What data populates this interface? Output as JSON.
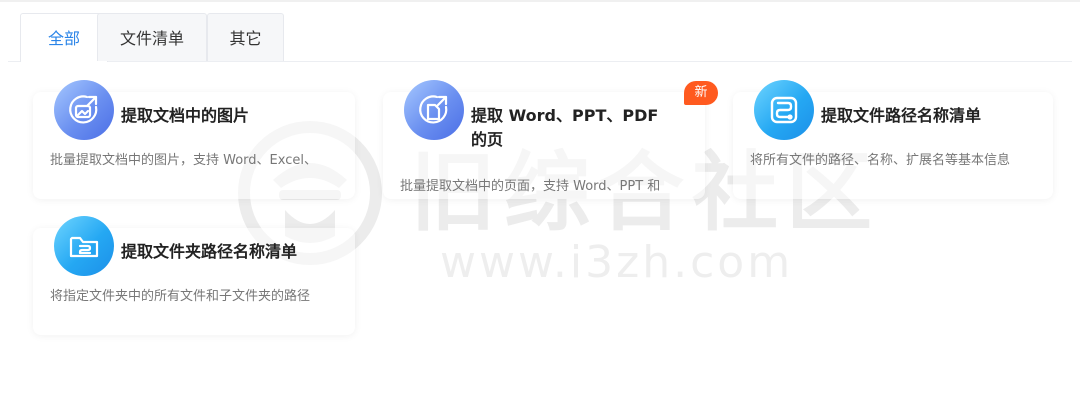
{
  "tabs": [
    {
      "label": "全部",
      "active": true
    },
    {
      "label": "文件清单",
      "active": false
    },
    {
      "label": "其它",
      "active": false
    }
  ],
  "cards": [
    {
      "title": "提取文档中的图片",
      "desc": "批量提取文档中的图片，支持 Word、Excel、",
      "icon": "image-extract-icon",
      "color": "#5b82ec"
    },
    {
      "title": "提取 Word、PPT、PDF 的页",
      "desc": "批量提取文档中的页面，支持 Word、PPT 和",
      "icon": "page-extract-icon",
      "color": "#5b82ec",
      "badge": "新"
    },
    {
      "title": "提取文件路径名称清单",
      "desc": "将所有文件的路径、名称、扩展名等基本信息",
      "icon": "path-list-icon",
      "color": "#1f9cf0"
    },
    {
      "title": "提取文件夹路径名称清单",
      "desc": "将指定文件夹中的所有文件和子文件夹的路径",
      "icon": "folder-path-icon",
      "color": "#1f9cf0"
    }
  ],
  "watermark": {
    "title": "旧综合社区",
    "url": "www.i3zh.com"
  },
  "colors": {
    "accent": "#2a84e8",
    "badge": "#ff5a1f"
  }
}
